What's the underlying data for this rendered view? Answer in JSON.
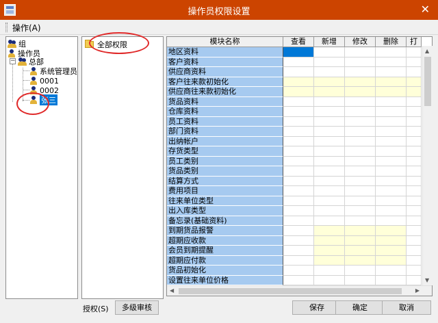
{
  "window": {
    "title": "操作员权限设置",
    "close_glyph": "✕"
  },
  "menu": {
    "operate": "操作(A)"
  },
  "tree": {
    "group": "组",
    "operator": "操作员",
    "headquarters": "总部",
    "users": [
      "系统管理员",
      "0001",
      "0002",
      "张三"
    ],
    "selected_user": "张三"
  },
  "permissions": {
    "all": "全部权限"
  },
  "grid": {
    "columns": [
      "模块名称",
      "查看",
      "新增",
      "修改",
      "删除",
      "打"
    ],
    "rows": [
      {
        "name": "地区资料",
        "cells": [
          "blue",
          "",
          "",
          "",
          ""
        ]
      },
      {
        "name": "客户资料",
        "cells": [
          "",
          "",
          "",
          "",
          ""
        ]
      },
      {
        "name": "供应商资料",
        "cells": [
          "",
          "",
          "",
          "",
          ""
        ]
      },
      {
        "name": "客户往来款初始化",
        "cells": [
          "yellow",
          "yellow",
          "yellow",
          "yellow",
          "yellow"
        ]
      },
      {
        "name": "供应商往来款初始化",
        "cells": [
          "yellow",
          "yellow",
          "yellow",
          "yellow",
          "yellow"
        ]
      },
      {
        "name": "货品资料",
        "cells": [
          "",
          "",
          "",
          "",
          ""
        ]
      },
      {
        "name": "仓库资料",
        "cells": [
          "",
          "",
          "",
          "",
          ""
        ]
      },
      {
        "name": "员工资料",
        "cells": [
          "",
          "",
          "",
          "",
          ""
        ]
      },
      {
        "name": "部门资料",
        "cells": [
          "",
          "",
          "",
          "",
          ""
        ]
      },
      {
        "name": "出纳帐户",
        "cells": [
          "",
          "",
          "",
          "",
          ""
        ]
      },
      {
        "name": "存货类型",
        "cells": [
          "",
          "",
          "",
          "",
          ""
        ]
      },
      {
        "name": "员工类别",
        "cells": [
          "",
          "",
          "",
          "",
          ""
        ]
      },
      {
        "name": "货品类别",
        "cells": [
          "",
          "",
          "",
          "",
          ""
        ]
      },
      {
        "name": "结算方式",
        "cells": [
          "",
          "",
          "",
          "",
          ""
        ]
      },
      {
        "name": "费用项目",
        "cells": [
          "",
          "",
          "",
          "",
          ""
        ]
      },
      {
        "name": "往来单位类型",
        "cells": [
          "",
          "",
          "",
          "",
          ""
        ]
      },
      {
        "name": "出入库类型",
        "cells": [
          "",
          "",
          "",
          "",
          ""
        ]
      },
      {
        "name": "备忘录(基础资料)",
        "cells": [
          "",
          "",
          "",
          "",
          ""
        ]
      },
      {
        "name": "到期货品报警",
        "cells": [
          "",
          "yellow",
          "yellow",
          "yellow",
          ""
        ]
      },
      {
        "name": "超期应收款",
        "cells": [
          "",
          "yellow",
          "yellow",
          "yellow",
          ""
        ]
      },
      {
        "name": "会员到期提醒",
        "cells": [
          "",
          "yellow",
          "yellow",
          "yellow",
          ""
        ]
      },
      {
        "name": "超期应付款",
        "cells": [
          "",
          "yellow",
          "yellow",
          "yellow",
          ""
        ]
      },
      {
        "name": "货品初始化",
        "cells": [
          "",
          "",
          "",
          "",
          ""
        ]
      },
      {
        "name": "设置往来单位价格",
        "cells": [
          "",
          "",
          "",
          "",
          ""
        ]
      }
    ]
  },
  "footer": {
    "authorize": "授权(S)",
    "multi_level_review": "多级审核",
    "save": "保存",
    "ok": "确定",
    "cancel": "取消"
  },
  "colors": {
    "titlebar": "#cc4400",
    "row_name_bg": "#a6caf0",
    "cell_yellow": "#ffffd9",
    "selection": "#0078d7",
    "annotation_circle": "#e02a2a"
  }
}
